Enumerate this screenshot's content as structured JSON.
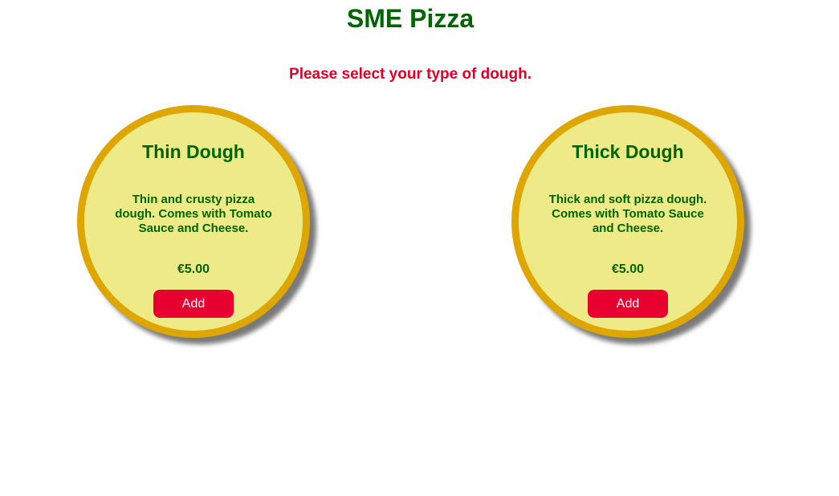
{
  "header": {
    "title": "SME Pizza",
    "instruction": "Please select your type of dough."
  },
  "products": [
    {
      "name": "Thin Dough",
      "description": "Thin and crusty pizza dough. Comes with Tomato Sauce and Cheese.",
      "price": "€5.00",
      "button_label": "Add"
    },
    {
      "name": "Thick Dough",
      "description": "Thick and soft pizza dough. Comes with Tomato Sauce and Cheese.",
      "price": "€5.00",
      "button_label": "Add"
    }
  ],
  "colors": {
    "title_green": "#006400",
    "instruction_red": "#e0002a",
    "card_fill": "#efea88",
    "card_border": "#dda600",
    "button_red": "#e80030"
  }
}
